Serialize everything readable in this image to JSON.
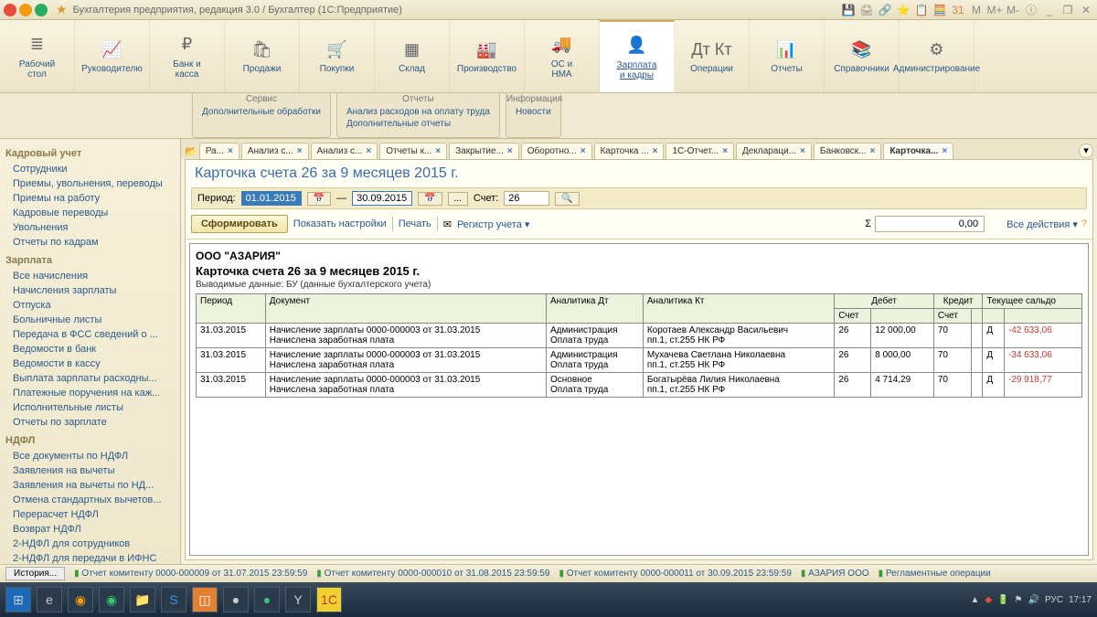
{
  "titlebar": {
    "title": "Бухгалтерия предприятия, редакция 3.0 / Бухгалтер  (1С:Предприятие)"
  },
  "ribbon": [
    {
      "icon": "≣",
      "label": "Рабочий\nстол"
    },
    {
      "icon": "📈",
      "label": "Руководителю"
    },
    {
      "icon": "₽",
      "label": "Банк и\nкасса"
    },
    {
      "icon": "🛍",
      "label": "Продажи"
    },
    {
      "icon": "🛒",
      "label": "Покупки"
    },
    {
      "icon": "▦",
      "label": "Склад"
    },
    {
      "icon": "🏭",
      "label": "Производство"
    },
    {
      "icon": "🚚",
      "label": "ОС и\nНМА"
    },
    {
      "icon": "👤",
      "label": "Зарплата\nи кадры",
      "active": true
    },
    {
      "icon": "Дт Кт",
      "label": "Операции"
    },
    {
      "icon": "📊",
      "label": "Отчеты"
    },
    {
      "icon": "📚",
      "label": "Справочники"
    },
    {
      "icon": "⚙",
      "label": "Администрирование"
    }
  ],
  "subribbon": [
    {
      "title": "Сервис",
      "links": [
        "Дополнительные обработки"
      ]
    },
    {
      "title": "Отчеты",
      "links": [
        "Анализ расходов на оплату труда",
        "Дополнительные отчеты"
      ]
    },
    {
      "title": "Информация",
      "links": [
        "Новости"
      ]
    }
  ],
  "sidebar": [
    {
      "head": "Кадровый учет",
      "links": [
        "Сотрудники",
        "Приемы, увольнения, переводы",
        "Приемы на работу",
        "Кадровые переводы",
        "Увольнения",
        "Отчеты по кадрам"
      ]
    },
    {
      "head": "Зарплата",
      "links": [
        "Все начисления",
        "Начисления зарплаты",
        "Отпуска",
        "Больничные листы",
        "Передача в ФСС сведений о ...",
        "Ведомости в банк",
        "Ведомости в кассу",
        "Выплата зарплаты расходны...",
        "Платежные поручения на каж...",
        "Исполнительные листы",
        "Отчеты по зарплате"
      ]
    },
    {
      "head": "НДФЛ",
      "links": [
        "Все документы по НДФЛ",
        "Заявления на вычеты",
        "Заявления на вычеты по НД...",
        "Отмена стандартных вычетов...",
        "Перерасчет НДФЛ",
        "Возврат НДФЛ",
        "2-НДФЛ для сотрудников",
        "2-НДФЛ для передачи в ИФНС",
        "Операции учета НДФЛ"
      ]
    }
  ],
  "tabs": [
    "Ра...",
    "Анализ с...",
    "Анализ с...",
    "Отчеты к...",
    "Закрытие...",
    "Оборотно...",
    "Карточка ...",
    "1С-Отчет...",
    "Деклараци...",
    "Банковск...",
    "Карточка..."
  ],
  "doc": {
    "title": "Карточка счета 26 за 9 месяцев 2015 г.",
    "period_label": "Период:",
    "date_from": "01.01.2015",
    "date_to": "30.09.2015",
    "dash": "—",
    "account_label": "Счет:",
    "account": "26",
    "btn_form": "Сформировать",
    "btn_settings": "Показать настройки",
    "btn_print": "Печать",
    "btn_register": "Регистр учета ▾",
    "sum_value": "0,00",
    "btn_actions": "Все действия ▾",
    "org": "ООО \"АЗАРИЯ\"",
    "rpt_title": "Карточка счета 26 за 9 месяцев 2015 г.",
    "rpt_sub": "Выводимые данные:   БУ (данные бухгалтерского учета)",
    "headers": {
      "period": "Период",
      "doc": "Документ",
      "adt": "Аналитика Дт",
      "akt": "Аналитика Кт",
      "debit": "Дебет",
      "credit": "Кредит",
      "acct": "Счет",
      "saldo": "Текущее сальдо"
    },
    "rows": [
      {
        "period": "31.03.2015",
        "doc": "Начисление зарплаты 0000-000003 от 31.03.2015\nНачислена заработная плата",
        "adt": "Администрация\nОплата труда",
        "akt": "Коротаев Александр Васильевич\nпп.1, ст.255 НК РФ",
        "dacct": "26",
        "dval": "12 000,00",
        "cacct": "70",
        "cval": "",
        "sdk": "Д",
        "saldo": "-42 633,06"
      },
      {
        "period": "31.03.2015",
        "doc": "Начисление зарплаты 0000-000003 от 31.03.2015\nНачислена заработная плата",
        "adt": "Администрация\nОплата труда",
        "akt": "Мухачева Светлана Николаевна\nпп.1, ст.255 НК РФ",
        "dacct": "26",
        "dval": "8 000,00",
        "cacct": "70",
        "cval": "",
        "sdk": "Д",
        "saldo": "-34 633,06"
      },
      {
        "period": "31.03.2015",
        "doc": "Начисление зарплаты 0000-000003 от 31.03.2015\nНачислена заработная плата",
        "adt": "Основное\nОплата труда",
        "akt": "Богатырёва Лилия Николаевна\nпп.1, ст.255 НК РФ",
        "dacct": "26",
        "dval": "4 714,29",
        "cacct": "70",
        "cval": "",
        "sdk": "Д",
        "saldo": "-29 918,77"
      }
    ]
  },
  "statusbar": {
    "history": "История...",
    "items": [
      "Отчет комитенту 0000-000009 от 31.07.2015 23:59:59",
      "Отчет комитенту 0000-000010 от 31.08.2015 23:59:59",
      "Отчет комитенту 0000-000011 от 30.09.2015 23:59:59",
      "АЗАРИЯ ООО",
      "Регламентные операции"
    ]
  },
  "taskbar": {
    "lang": "РУС",
    "time": "17:17"
  }
}
